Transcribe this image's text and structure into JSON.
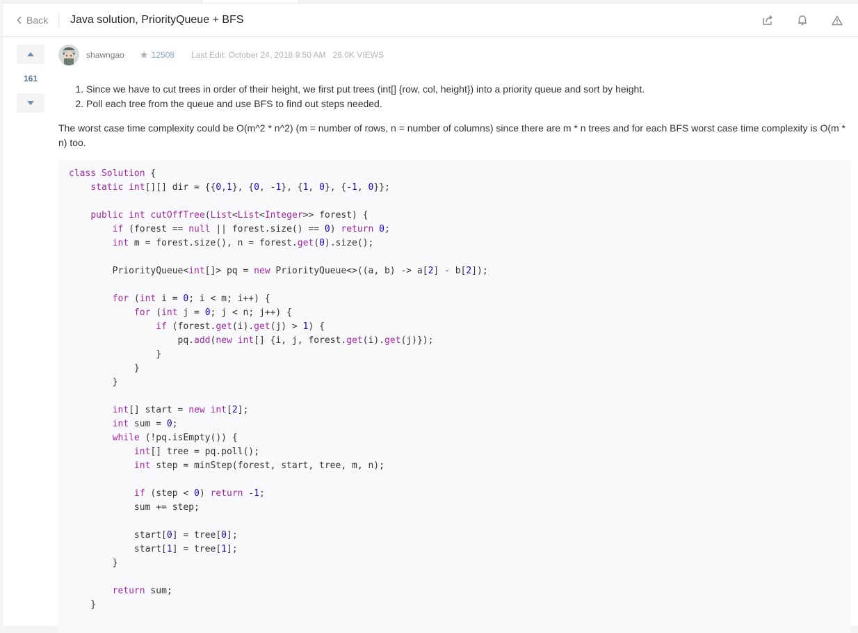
{
  "header": {
    "back_label": "Back",
    "title": "Java solution, PriorityQueue + BFS",
    "icons": [
      "share-icon",
      "bell-icon",
      "warning-icon"
    ]
  },
  "votes": {
    "count": "161"
  },
  "meta": {
    "author": "shawngao",
    "reputation": "12508",
    "last_edit": "Last Edit: October 24, 2018 9:50 AM",
    "views": "26.0K VIEWS"
  },
  "post": {
    "steps": [
      "Since we have to cut trees in order of their height, we first put trees (int[] {row, col, height}) into a priority queue and sort by height.",
      "Poll each tree from the queue and use BFS to find out steps needed."
    ],
    "paragraph": "The worst case time complexity could be O(m^2 * n^2) (m = number of rows, n = number of columns) since there are m * n trees and for each BFS worst case time complexity is O(m * n) too."
  },
  "code": {
    "lines": [
      "class Solution {",
      "    static int[][] dir = {{0,1}, {0, -1}, {1, 0}, {-1, 0}};",
      "",
      "    public int cutOffTree(List<List<Integer>> forest) {",
      "        if (forest == null || forest.size() == 0) return 0;",
      "        int m = forest.size(), n = forest.get(0).size();",
      "",
      "        PriorityQueue<int[]> pq = new PriorityQueue<>((a, b) -> a[2] - b[2]);",
      "",
      "        for (int i = 0; i < m; i++) {",
      "            for (int j = 0; j < n; j++) {",
      "                if (forest.get(i).get(j) > 1) {",
      "                    pq.add(new int[] {i, j, forest.get(i).get(j)});",
      "                }",
      "            }",
      "        }",
      "",
      "        int[] start = new int[2];",
      "        int sum = 0;",
      "        while (!pq.isEmpty()) {",
      "            int[] tree = pq.poll();",
      "            int step = minStep(forest, start, tree, m, n);",
      "",
      "            if (step < 0) return -1;",
      "            sum += step;",
      "",
      "            start[0] = tree[0];",
      "            start[1] = tree[1];",
      "        }",
      "",
      "        return sum;",
      "    }"
    ]
  }
}
